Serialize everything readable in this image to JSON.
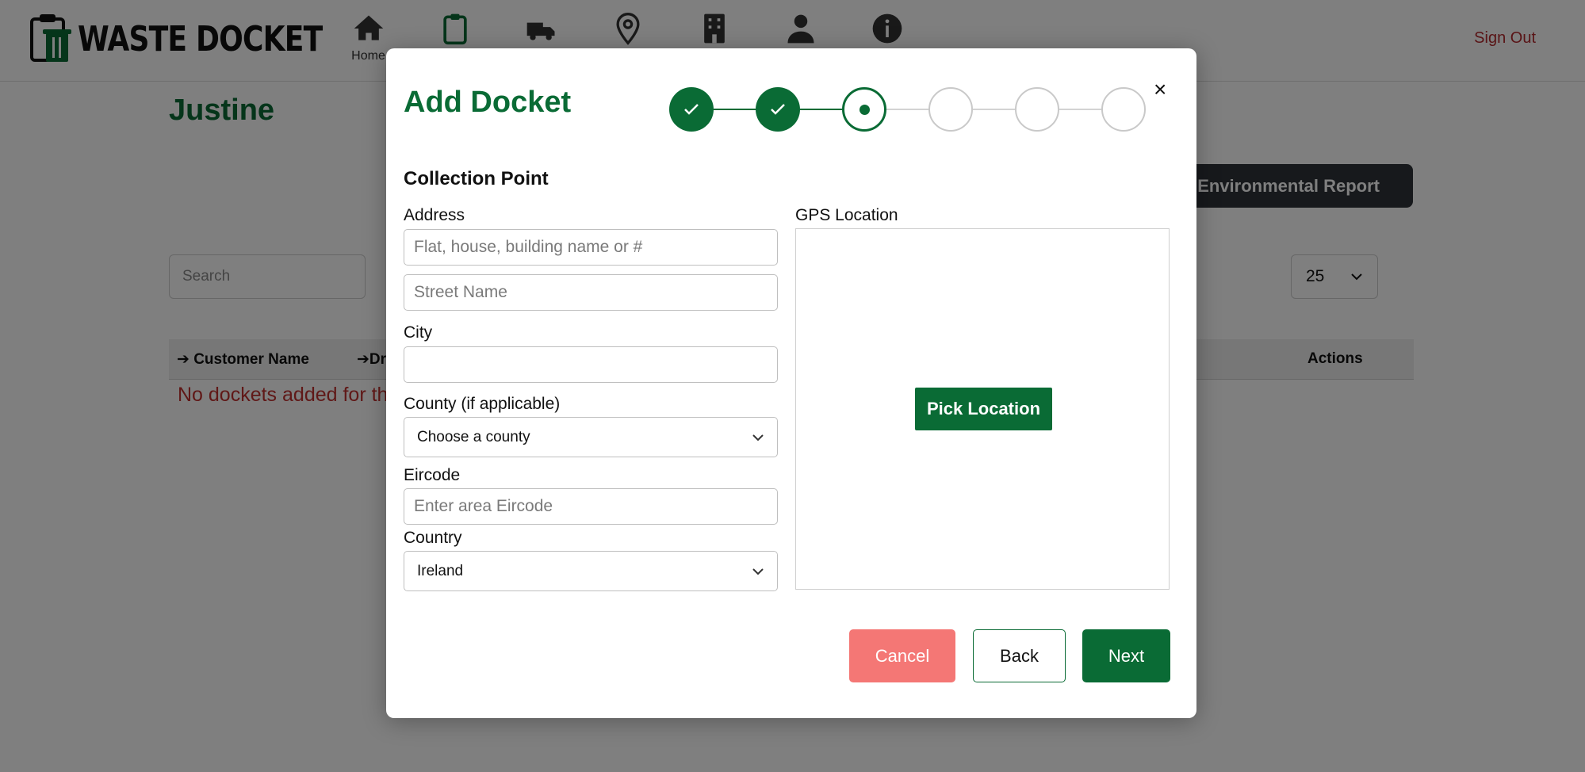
{
  "app": {
    "logo_text": "WASTE DOCKET",
    "nav": [
      {
        "icon": "home-icon",
        "label": "Home"
      },
      {
        "icon": "clipboard-icon",
        "label": ""
      },
      {
        "icon": "truck-icon",
        "label": ""
      },
      {
        "icon": "map-pin-icon",
        "label": ""
      },
      {
        "icon": "building-icon",
        "label": ""
      },
      {
        "icon": "person-icon",
        "label": ""
      },
      {
        "icon": "info-icon",
        "label": ""
      }
    ],
    "sign_out": "Sign Out",
    "page_title": "Justine",
    "env_report_button": "Environmental Report",
    "search_placeholder": "Search",
    "page_size": "25",
    "table": {
      "columns": [
        "Customer Name",
        "Dri",
        "Actions"
      ]
    },
    "empty_message": "No dockets added for th"
  },
  "modal": {
    "title": "Add Docket",
    "close_label": "×",
    "stepper": {
      "total": 6,
      "current": 3,
      "completed": 2
    },
    "section_title": "Collection Point",
    "address_label": "Address",
    "address_line1_placeholder": "Flat, house, building name or #",
    "street_placeholder": "Street Name",
    "city_label": "City",
    "city_value": "",
    "county_label": "County (if applicable)",
    "county_selected": "Choose a county",
    "eircode_label": "Eircode",
    "eircode_placeholder": "Enter area Eircode",
    "country_label": "Country",
    "country_selected": "Ireland",
    "gps_label": "GPS Location",
    "pick_location_button": "Pick Location",
    "buttons": {
      "cancel": "Cancel",
      "back": "Back",
      "next": "Next"
    }
  },
  "colors": {
    "brand_green": "#0a6b35",
    "cancel_red": "#f47775",
    "signout_red": "#b3282d",
    "dark_button": "#2f3338"
  }
}
